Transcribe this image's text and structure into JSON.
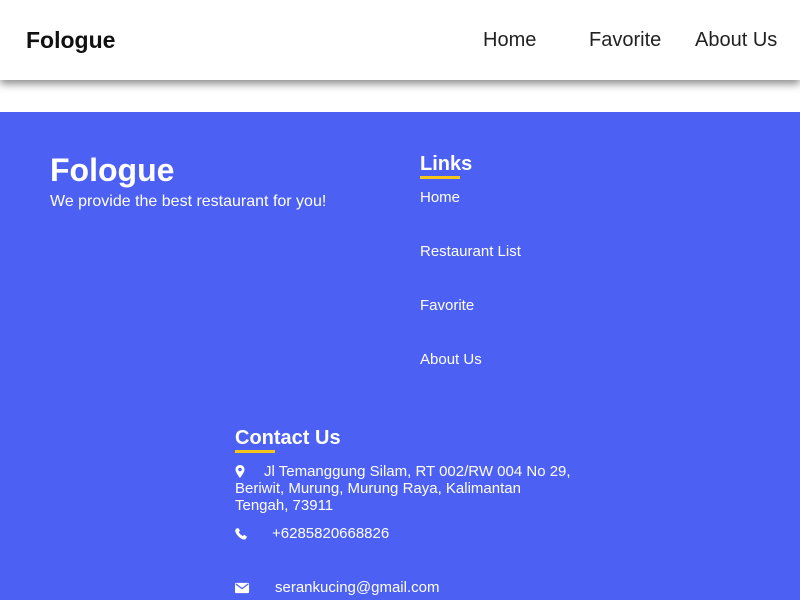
{
  "header": {
    "brand": "Fologue",
    "nav": {
      "home": "Home",
      "favorite": "Favorite",
      "about": "About Us"
    }
  },
  "footer": {
    "title": "Fologue",
    "tagline": "We provide the best restaurant for you!",
    "links": {
      "heading": "Links",
      "items": [
        "Home",
        "Restaurant List",
        "Favorite",
        "About Us"
      ]
    },
    "contact": {
      "heading": "Contact Us",
      "address": "Jl Temanggung Silam, RT 002/RW 004 No 29, Beriwit, Murung, Murung Raya, Kalimantan Tengah, 73911",
      "phone": "+6285820668826",
      "email": "serankucing@gmail.com",
      "icons": [
        "map-marker-icon",
        "phone-icon",
        "envelope-icon"
      ]
    }
  },
  "colors": {
    "footer_background": "#4c60f4",
    "underline_accent": "#f5c518",
    "header_background": "#ffffff"
  }
}
